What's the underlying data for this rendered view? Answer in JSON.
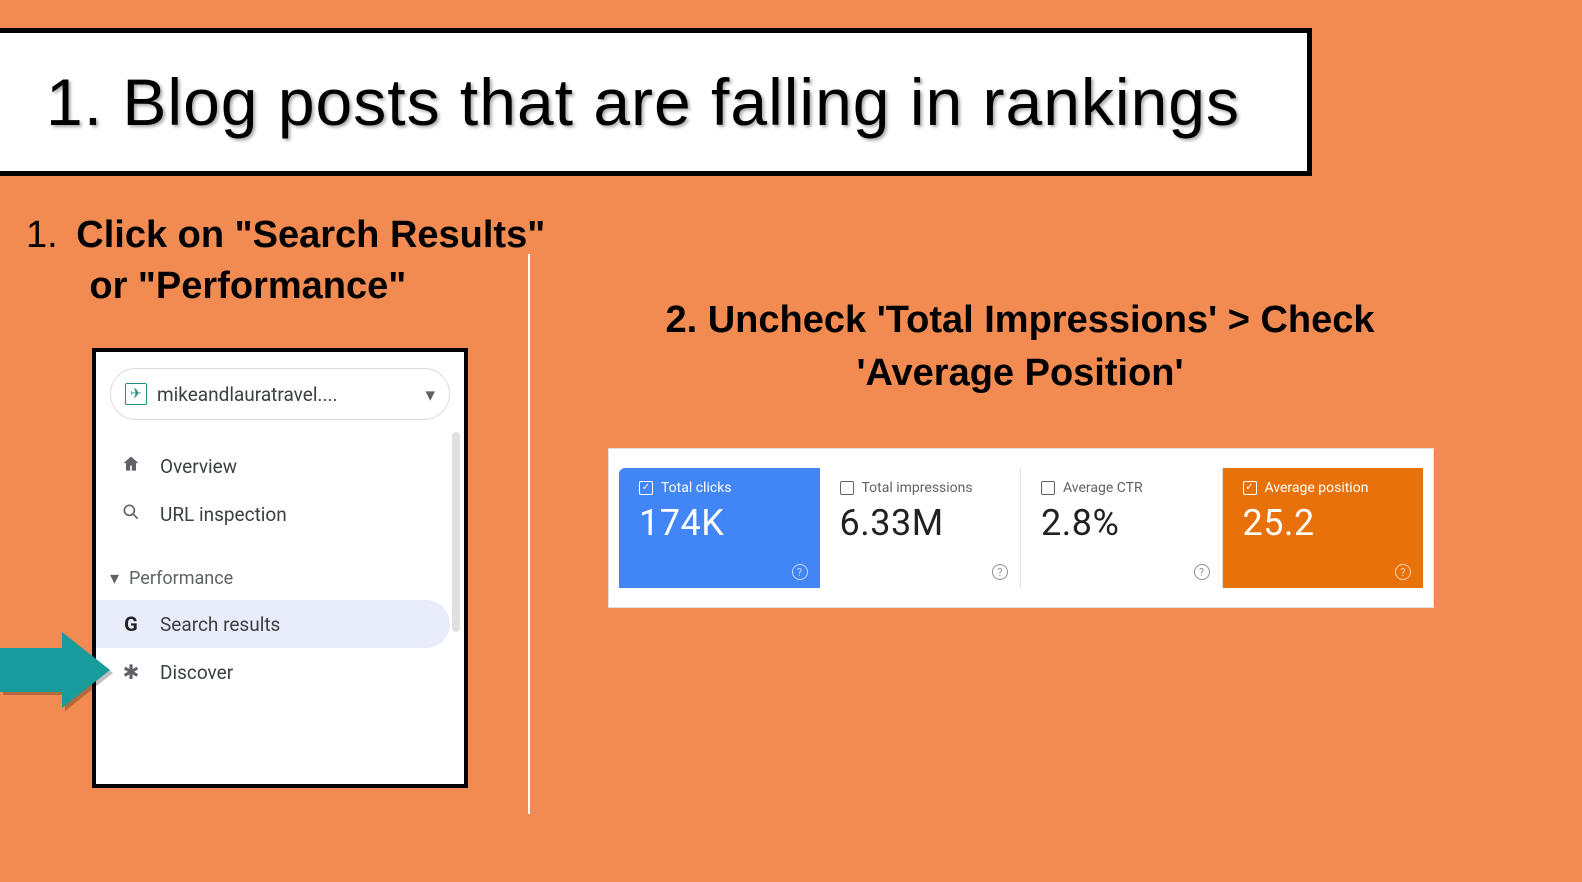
{
  "title": "1. Blog posts that are falling in rankings",
  "step1": {
    "num": "1.",
    "line1": "Click on \"Search Results\"",
    "line2": "or \"Performance\""
  },
  "sidebar": {
    "site": "mikeandlauratravel....",
    "items": {
      "overview": "Overview",
      "url_inspection": "URL inspection",
      "performance_section": "Performance",
      "search_results": "Search results",
      "discover": "Discover"
    }
  },
  "step2": {
    "line1": "2. Uncheck 'Total Impressions' > Check",
    "line2": "'Average Position'"
  },
  "metrics": {
    "clicks": {
      "label": "Total clicks",
      "value": "174K",
      "checked": "✓"
    },
    "impressions": {
      "label": "Total impressions",
      "value": "6.33M",
      "checked": ""
    },
    "ctr": {
      "label": "Average CTR",
      "value": "2.8%",
      "checked": ""
    },
    "position": {
      "label": "Average position",
      "value": "25.2",
      "checked": "✓"
    }
  },
  "help_glyph": "?"
}
